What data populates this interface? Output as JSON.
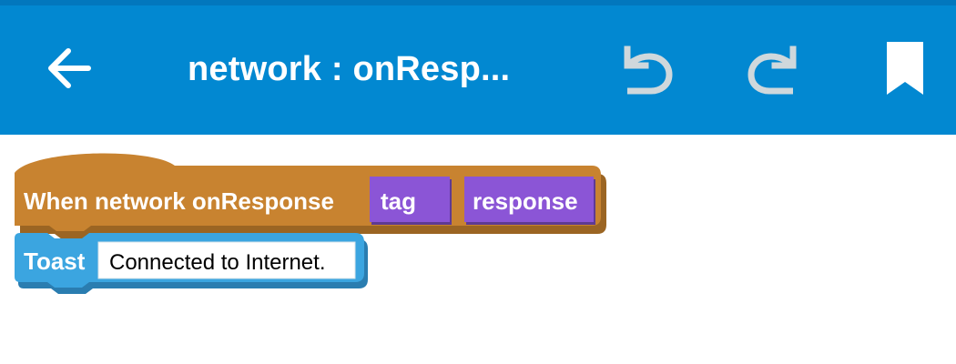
{
  "theme": {
    "primary": "#0288D1",
    "event_block": "#C88330",
    "param_block": "#8B55D6",
    "toast_block": "#3BA5E0"
  },
  "toolbar": {
    "title": "network : onResp...",
    "back_icon": "arrow-left-icon",
    "undo_icon": "undo-icon",
    "redo_icon": "redo-icon",
    "bookmark_icon": "bookmark-icon"
  },
  "blocks": {
    "event": {
      "label": "When network onResponse",
      "params": [
        "tag",
        "response"
      ]
    },
    "toast": {
      "label": "Toast",
      "message": "Connected to Internet."
    }
  }
}
